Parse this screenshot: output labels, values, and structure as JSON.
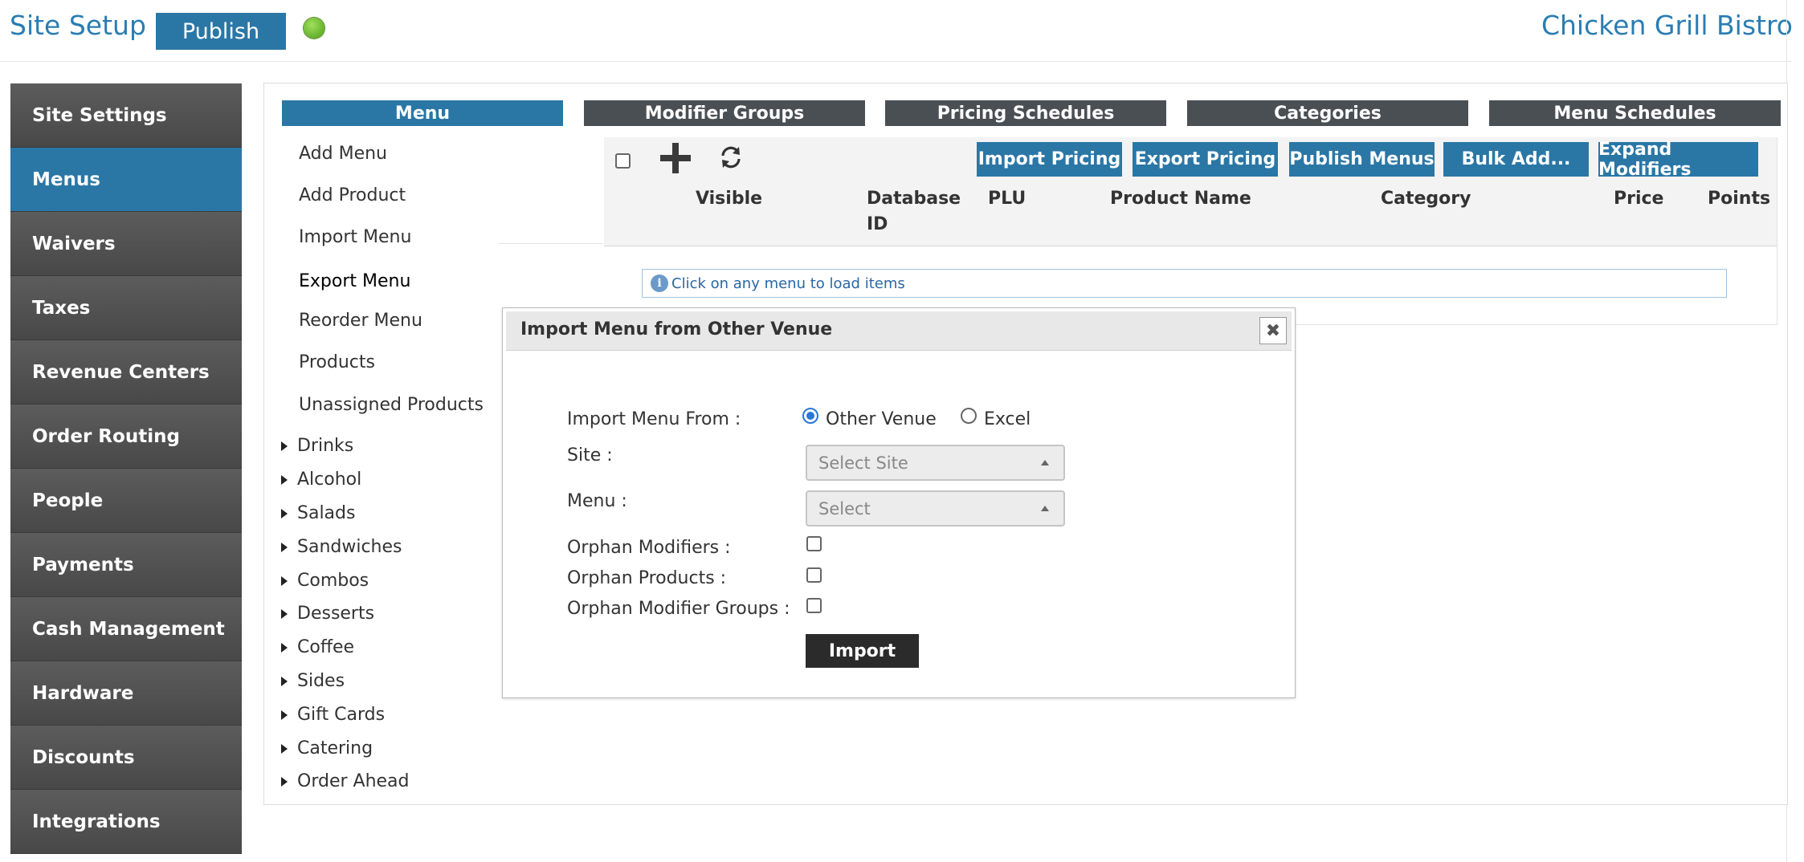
{
  "header": {
    "title": "Site Setup",
    "publish_label": "Publish",
    "venue_name": "Chicken Grill Bistro"
  },
  "sidebar": {
    "items": [
      {
        "label": "Site Settings"
      },
      {
        "label": "Menus"
      },
      {
        "label": "Waivers"
      },
      {
        "label": "Taxes"
      },
      {
        "label": "Revenue Centers"
      },
      {
        "label": "Order Routing"
      },
      {
        "label": "People"
      },
      {
        "label": "Payments"
      },
      {
        "label": "Cash Management"
      },
      {
        "label": "Hardware"
      },
      {
        "label": "Discounts"
      },
      {
        "label": "Integrations"
      }
    ],
    "active_index": 1
  },
  "tabs": [
    {
      "label": "Menu"
    },
    {
      "label": "Modifier Groups"
    },
    {
      "label": "Pricing Schedules"
    },
    {
      "label": "Categories"
    },
    {
      "label": "Menu Schedules"
    }
  ],
  "menu_actions": [
    {
      "label": "Add Menu"
    },
    {
      "label": "Add Product"
    },
    {
      "label": "Import Menu"
    },
    {
      "label": "Export Menu"
    },
    {
      "label": "Reorder Menu"
    },
    {
      "label": "Products"
    },
    {
      "label": "Unassigned Products"
    }
  ],
  "menu_tree": [
    {
      "label": "Drinks"
    },
    {
      "label": "Alcohol"
    },
    {
      "label": "Salads"
    },
    {
      "label": "Sandwiches"
    },
    {
      "label": "Combos"
    },
    {
      "label": "Desserts"
    },
    {
      "label": "Coffee"
    },
    {
      "label": "Sides"
    },
    {
      "label": "Gift Cards"
    },
    {
      "label": "Catering"
    },
    {
      "label": "Order Ahead"
    }
  ],
  "toolbar": {
    "buttons": [
      {
        "label": "Import Pricing"
      },
      {
        "label": "Export Pricing"
      },
      {
        "label": "Publish Menus"
      },
      {
        "label": "Bulk Add..."
      },
      {
        "label": "Expand Modifiers"
      }
    ]
  },
  "grid": {
    "columns": [
      {
        "label": "Visible"
      },
      {
        "label": "Database ID"
      },
      {
        "label": "PLU"
      },
      {
        "label": "Product Name"
      },
      {
        "label": "Category"
      },
      {
        "label": "Price"
      },
      {
        "label": "Points"
      }
    ],
    "info_message": "Click on any menu to load items"
  },
  "modal": {
    "title": "Import Menu from Other Venue",
    "import_from_label": "Import Menu From :",
    "option_other_venue": "Other Venue",
    "option_excel": "Excel",
    "selected_option": "Other Venue",
    "site_label": "Site :",
    "site_placeholder": "Select Site",
    "menu_label": "Menu :",
    "menu_placeholder": "Select",
    "orphan_modifiers_label": "Orphan Modifiers :",
    "orphan_products_label": "Orphan Products :",
    "orphan_modifier_groups_label": "Orphan Modifier Groups :",
    "orphan_modifiers_checked": false,
    "orphan_products_checked": false,
    "orphan_modifier_groups_checked": false,
    "import_label": "Import"
  },
  "colors": {
    "accent": "#2a77a6",
    "sidebar_bg": "#4f4f4f",
    "tab_bg": "#4a4f54",
    "status_dot": "#6cc02c"
  }
}
